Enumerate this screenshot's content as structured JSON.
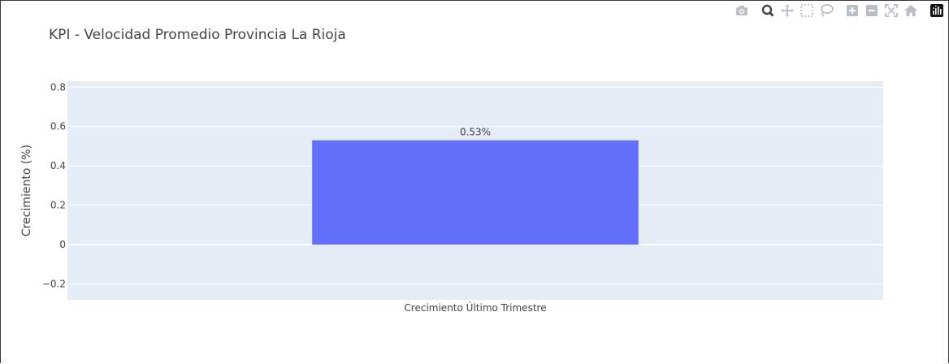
{
  "chart_data": {
    "type": "bar",
    "title": "KPI - Velocidad Promedio Provincia La Rioja",
    "categories": [
      "Crecimiento Último Trimestre"
    ],
    "values": [
      0.53
    ],
    "data_labels": [
      "0.53%"
    ],
    "xlabel": "",
    "ylabel": "Crecimiento (%)",
    "ylim": [
      -0.28,
      0.83
    ],
    "yticks": [
      -0.2,
      0,
      0.2,
      0.4,
      0.6,
      0.8
    ],
    "ytick_labels": [
      "−0.2",
      "0",
      "0.2",
      "0.4",
      "0.6",
      "0.8"
    ],
    "bar_color": "#636efa",
    "plot_bg": "#e5ecf6",
    "grid": true,
    "legend": "none"
  },
  "modebar": {
    "buttons": [
      "camera-icon",
      "zoom-icon",
      "pan-icon",
      "box-select-icon",
      "lasso-icon",
      "zoom-in-icon",
      "zoom-out-icon",
      "autoscale-icon",
      "home-icon",
      "plotly-logo-icon"
    ]
  }
}
